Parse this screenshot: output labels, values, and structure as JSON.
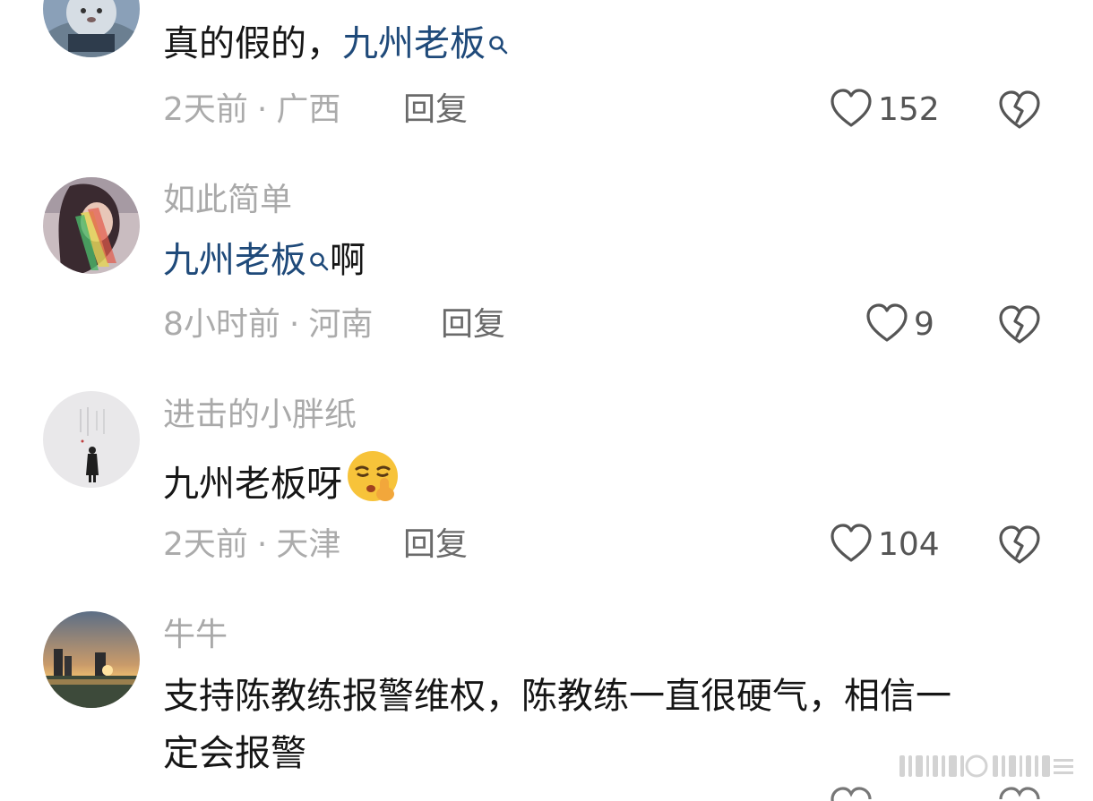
{
  "comments": [
    {
      "username": "",
      "body_prefix": "真的假的，",
      "topic": "九州老板",
      "body_suffix": "",
      "time": "2天前",
      "separator": "·",
      "location": "广西",
      "reply_label": "回复",
      "likes": "152"
    },
    {
      "username": "如此简单",
      "body_prefix": "",
      "topic": "九州老板",
      "body_suffix": "啊",
      "time": "8小时前",
      "separator": "·",
      "location": "河南",
      "reply_label": "回复",
      "likes": "9"
    },
    {
      "username": "进击的小胖纸",
      "body_prefix": "九州老板呀",
      "topic": "",
      "body_suffix": "",
      "time": "2天前",
      "separator": "·",
      "location": "天津",
      "reply_label": "回复",
      "likes": "104"
    },
    {
      "username": "牛牛",
      "body_line1": "支持陈教练报警维权，陈教练一直很硬气，相信一",
      "body_line2": "定会报警"
    }
  ],
  "icons": {
    "like": "heart-outline-icon",
    "dislike": "broken-heart-icon",
    "topic_search": "search-icon",
    "emoji": "shushing-face-emoji"
  },
  "colors": {
    "topic_link": "#1f4a7a",
    "meta_text": "#ababab",
    "username": "#a9a9a9",
    "body_text": "#161616"
  }
}
